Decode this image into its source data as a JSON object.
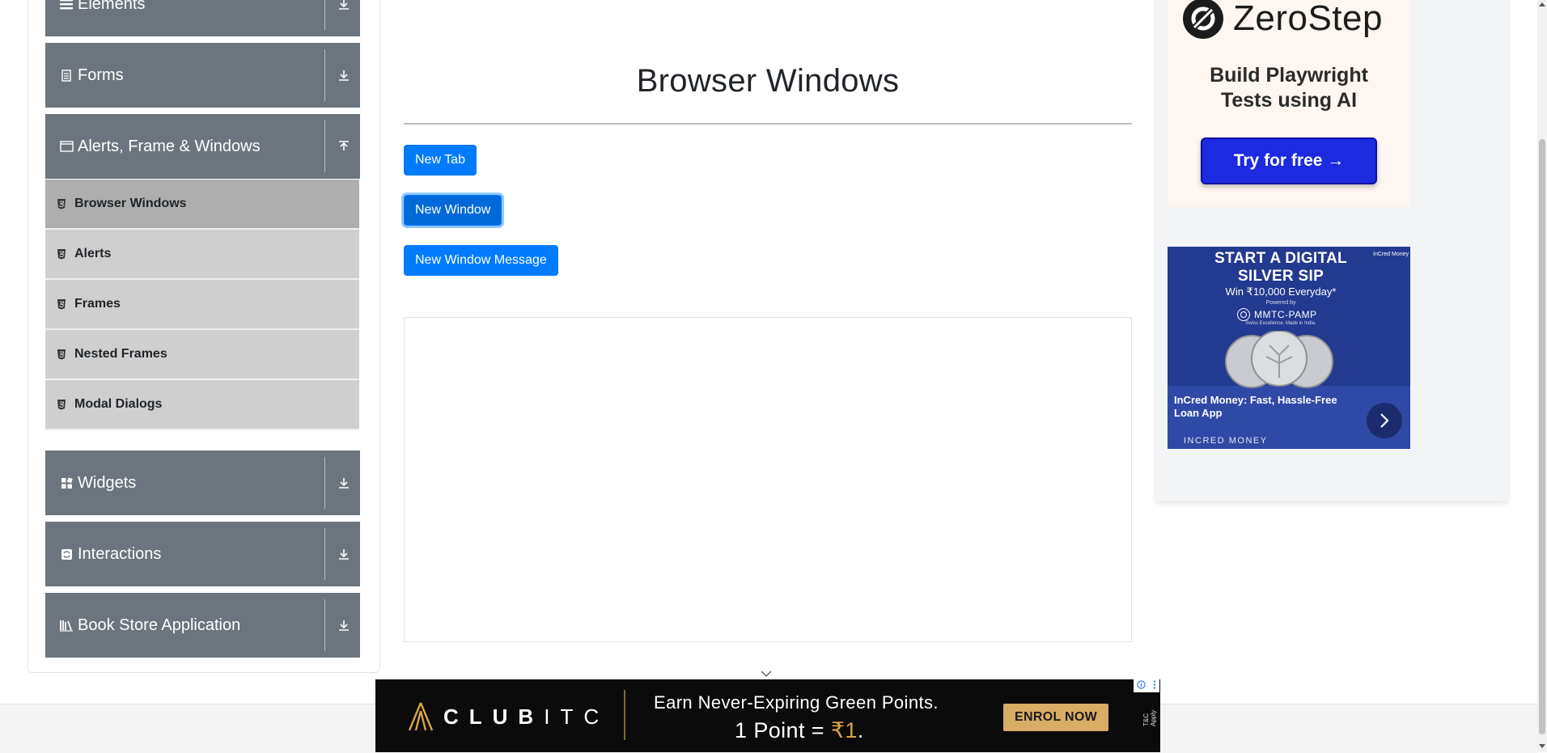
{
  "sidebar": {
    "groups": [
      {
        "label": "Elements"
      },
      {
        "label": "Forms"
      },
      {
        "label": "Alerts, Frame & Windows"
      },
      {
        "label": "Widgets"
      },
      {
        "label": "Interactions"
      },
      {
        "label": "Book Store Application"
      }
    ],
    "sub_items": [
      {
        "label": "Browser Windows",
        "active": true
      },
      {
        "label": "Alerts"
      },
      {
        "label": "Frames"
      },
      {
        "label": "Nested Frames"
      },
      {
        "label": "Modal Dialogs"
      }
    ]
  },
  "main": {
    "title": "Browser Windows",
    "buttons": {
      "new_tab": "New Tab",
      "new_window": "New Window",
      "new_window_message": "New Window Message"
    }
  },
  "ads": {
    "zerostep": {
      "logo": "ZeroStep",
      "headline_line1": "Build Playwright",
      "headline_line2": "Tests using AI",
      "cta": "Try for free →"
    },
    "incred": {
      "headline_line1": "START A DIGITAL",
      "headline_line2": "SILVER SIP",
      "subline": "Win ₹10,000 Everyday*",
      "powered_by": "Powered by",
      "partner": "MMTC-PAMP",
      "partner_tagline": "Swiss Excellence. Made in India.",
      "caption": "InCred Money: Fast, Hassle-Free Loan App",
      "brand": "INCRED MONEY",
      "badge": "InCred Money"
    },
    "club_itc": {
      "logo_bold": "CLUB",
      "logo_thin": "ITC",
      "line1": "Earn Never-Expiring Green Points.",
      "line2_prefix": "1 Point = ",
      "line2_value": "₹1",
      "line2_suffix": ".",
      "cta": "ENROL NOW",
      "terms": "T&C Apply"
    }
  },
  "colors": {
    "nav_header": "#6c757d",
    "nav_sub": "#cfcfcf",
    "nav_sub_active": "#aeaeae",
    "primary_button": "#007bff",
    "zerostep_cta": "#1c2be0"
  }
}
